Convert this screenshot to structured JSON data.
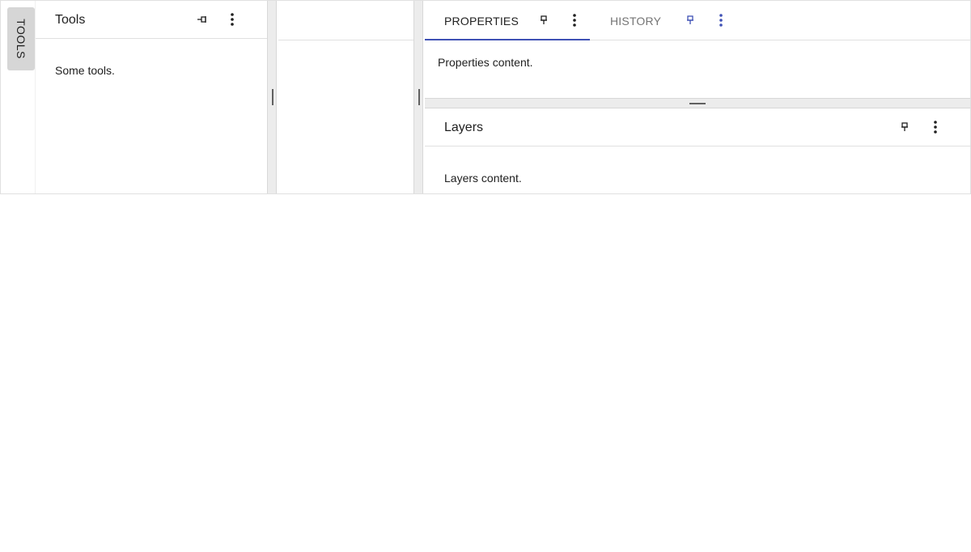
{
  "side_strip": {
    "tab_label": "TOOLS"
  },
  "tools_panel": {
    "title": "Tools",
    "content": "Some tools.",
    "pin_icon": "pin-icon",
    "menu_icon": "more-vert-icon"
  },
  "properties_group": {
    "tabs": [
      {
        "label": "PROPERTIES",
        "active": true,
        "pin_icon": "pin-icon",
        "menu_icon": "more-vert-icon"
      },
      {
        "label": "HISTORY",
        "active": false,
        "pin_icon": "pin-icon",
        "menu_icon": "more-vert-icon"
      }
    ],
    "content": "Properties content."
  },
  "layers_panel": {
    "title": "Layers",
    "content": "Layers content.",
    "pin_icon": "pin-icon",
    "menu_icon": "more-vert-icon"
  },
  "colors": {
    "accent": "#3f51b5",
    "splitter": "#ececec",
    "side_tab": "#d6d6d6"
  }
}
